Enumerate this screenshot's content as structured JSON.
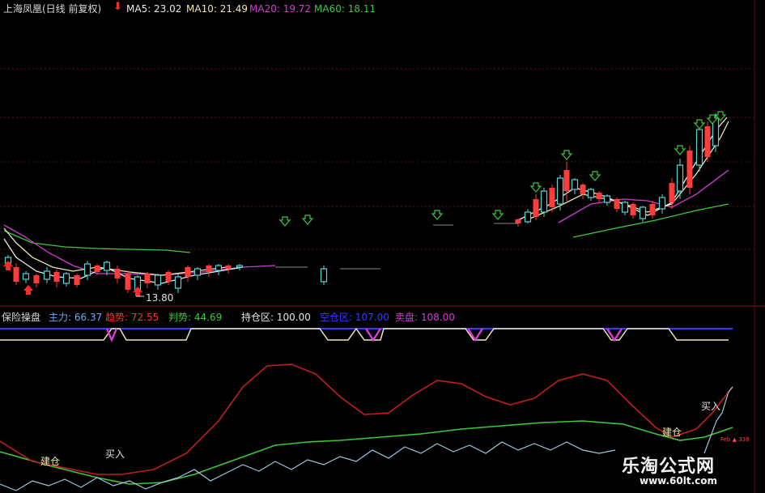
{
  "header": {
    "title": "上海凤凰(日线 前复权)",
    "ma5_label": "MA5: 23.02",
    "ma10_label": "MA10: 21.49",
    "ma20_label": "MA20: 19.72",
    "ma60_label": "MA60: 18.11",
    "colors": {
      "title": "#d8d8d8",
      "ma5": "#e8e8e8",
      "ma10": "#f0e6b0",
      "ma20": "#d23cd2",
      "ma60": "#3cc83c",
      "arrow": "#ff2a2a"
    }
  },
  "indicator_header": {
    "name": "保险操盘",
    "zhuli": "主力: 66.37",
    "qushi": "趋势: 72.55",
    "panshi": "判势: 44.69",
    "chicang": "持仓区: 100.00",
    "kongcang": "空仓区: 107.00",
    "maipan": "卖盘: 108.00",
    "colors": {
      "name": "#d8d8d8",
      "zhuli": "#66aaff",
      "qushi": "#ff3030",
      "panshi": "#3cc83c",
      "chicang": "#e8e8e8",
      "kongcang": "#3a3aff",
      "maipan": "#d23cd2"
    }
  },
  "annotations": {
    "low_price": "13.80",
    "jiancang_1": "建仓",
    "mairu_1": "买入",
    "jiancang_2": "建仓",
    "mairu_2": "买入",
    "tiny_mark": "Feb ▲ 338"
  },
  "watermark": {
    "name": "乐淘公式网",
    "url": "www.60lt.com"
  },
  "chart_data": [
    {
      "type": "candlestick",
      "title": "上海凤凰(日线 前复权)",
      "ylim": [
        13,
        27
      ],
      "grid": false,
      "series_names": [
        "MA5",
        "MA10",
        "MA20",
        "MA60"
      ],
      "annotated_low": 13.8
    },
    {
      "type": "line",
      "title": "保险操盘",
      "series": [
        {
          "name": "主力",
          "last": 66.37,
          "color": "#66aaff"
        },
        {
          "name": "趋势",
          "last": 72.55,
          "color": "#ff3030"
        },
        {
          "name": "判势",
          "last": 44.69,
          "color": "#3cc83c"
        },
        {
          "name": "持仓区",
          "last": 100.0,
          "color": "#e8e8e8"
        },
        {
          "name": "空仓区",
          "last": 107.0,
          "color": "#3a3aff"
        },
        {
          "name": "卖盘",
          "last": 108.0,
          "color": "#d23cd2"
        }
      ]
    }
  ]
}
